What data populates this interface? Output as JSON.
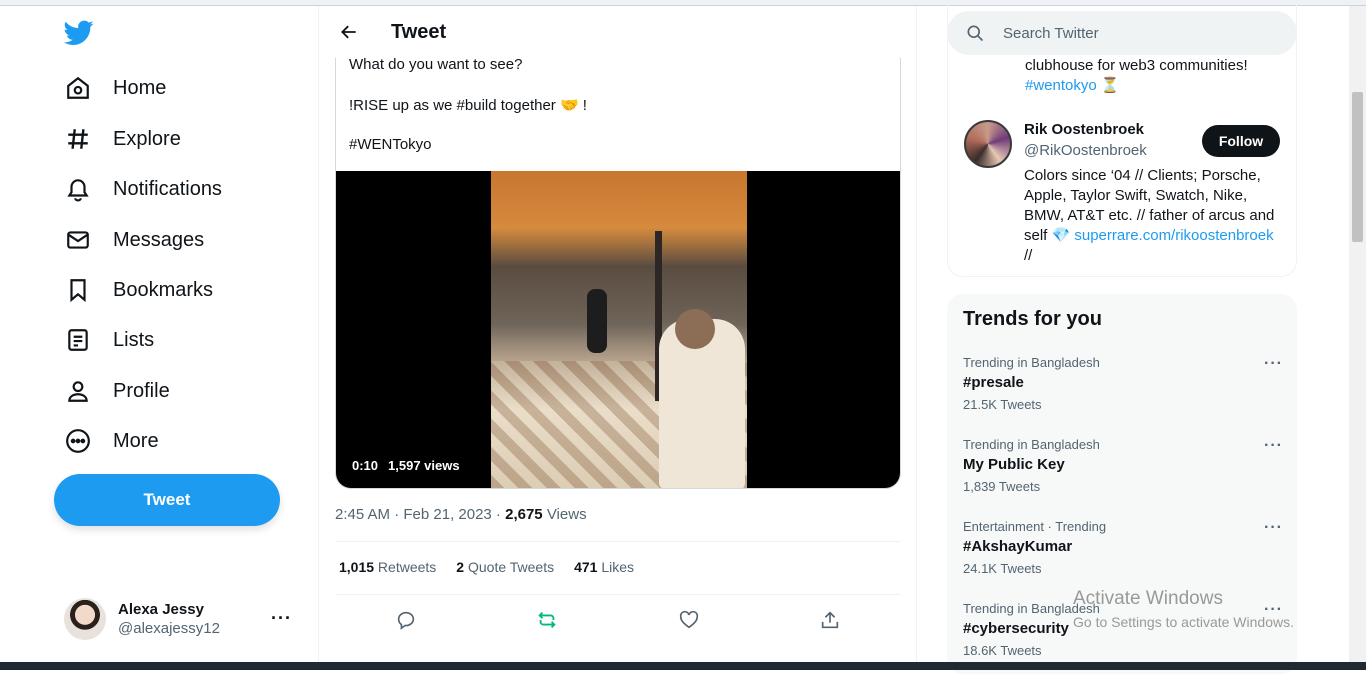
{
  "nav": {
    "items": [
      {
        "label": "Home",
        "icon": "home-icon"
      },
      {
        "label": "Explore",
        "icon": "hashtag-icon"
      },
      {
        "label": "Notifications",
        "icon": "bell-icon"
      },
      {
        "label": "Messages",
        "icon": "envelope-icon"
      },
      {
        "label": "Bookmarks",
        "icon": "bookmark-icon"
      },
      {
        "label": "Lists",
        "icon": "list-icon"
      },
      {
        "label": "Profile",
        "icon": "person-icon"
      },
      {
        "label": "More",
        "icon": "more-circle-icon"
      }
    ],
    "tweet_button": "Tweet"
  },
  "account": {
    "name": "Alexa Jessy",
    "handle": "@alexajessy12",
    "more": "···"
  },
  "header": {
    "title": "Tweet"
  },
  "quote": {
    "line1": "What do you want to see?",
    "line2": "!RISE up as we #build together 🤝 !",
    "line3": "#WENTokyo",
    "video_time": "0:10",
    "video_views": "1,597 views"
  },
  "tweet": {
    "time": "2:45 AM · Feb 21, 2023 · ",
    "views_count": "2,675",
    "views_label": " Views",
    "retweets_count": "1,015",
    "retweets_label": " Retweets",
    "quotes_count": "2",
    "quotes_label": " Quote Tweets",
    "likes_count": "471",
    "likes_label": " Likes"
  },
  "search": {
    "placeholder": "Search Twitter"
  },
  "who_to_follow": {
    "prev_bio_line": "clubhouse for web3 communities!",
    "prev_bio_tag": "#wentokyo",
    "prev_bio_emoji": " ⏳",
    "name": "Rik Oostenbroek",
    "handle": "@RikOostenbroek",
    "follow_label": "Follow",
    "bio": "Colors since ‘04 // Clients; Porsche, Apple, Taylor Swift, Swatch, Nike, BMW, AT&T etc. // father of arcus and self 💎",
    "bio_link": "superrare.com/rikoostenbroek",
    "bio_tail": " //"
  },
  "trends": {
    "title": "Trends for you",
    "items": [
      {
        "meta": "Trending in Bangladesh",
        "name": "#presale",
        "count": "21.5K Tweets"
      },
      {
        "meta": "Trending in Bangladesh",
        "name": "My Public Key",
        "count": "1,839 Tweets"
      },
      {
        "meta": "Entertainment · Trending",
        "name": "#AkshayKumar",
        "count": "24.1K Tweets"
      },
      {
        "meta": "Trending in Bangladesh",
        "name": "#cybersecurity",
        "count": "18.6K Tweets"
      }
    ],
    "more": "···"
  },
  "watermark": {
    "line1": "Activate Windows",
    "line2": "Go to Settings to activate Windows."
  },
  "colors": {
    "accent": "#1d9bf0",
    "retweet": "#00ba7c",
    "text": "#0f1419",
    "muted": "#536471"
  }
}
